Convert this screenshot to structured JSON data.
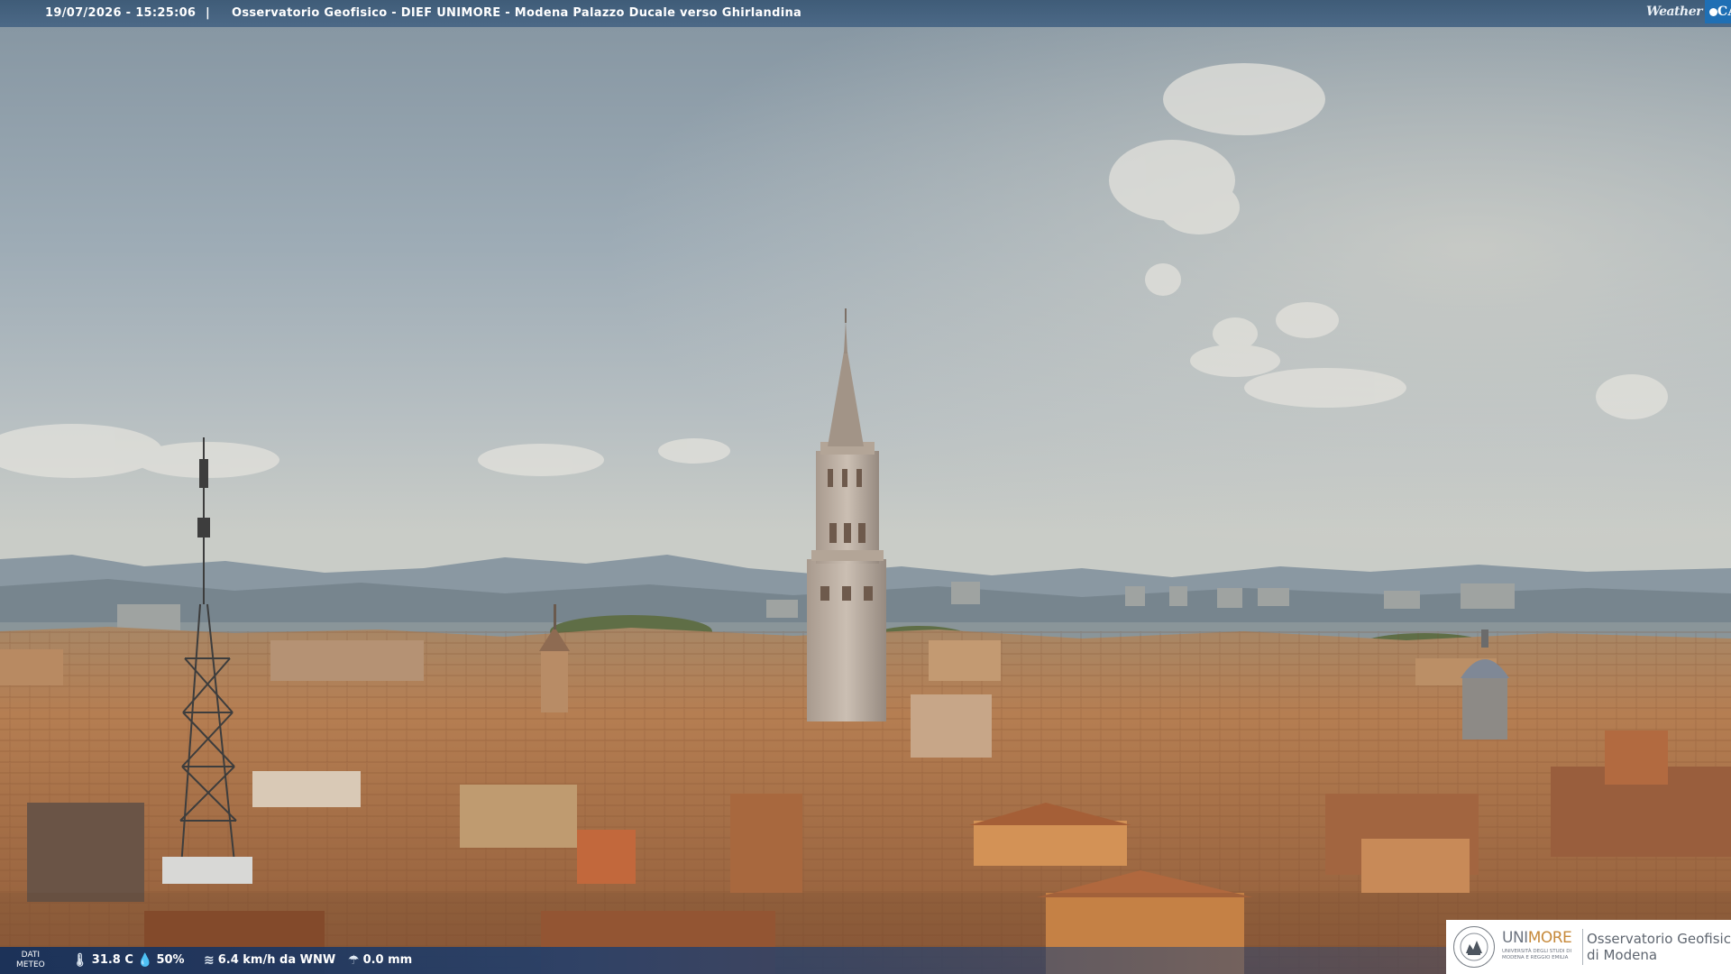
{
  "header": {
    "datetime": "19/07/2026 - 15:25:06",
    "separator": "|",
    "camera_title": "Osservatorio Geofisico - DIEF UNIMORE - Modena Palazzo Ducale verso Ghirlandina",
    "brand_weather": "Weather",
    "brand_cam": "CAM"
  },
  "meteo": {
    "label_line1": "DATI",
    "label_line2": "METEO",
    "temperature": "31.8 C",
    "humidity": "50%",
    "wind": "6.4 km/h da WNW",
    "rain": "0.0 mm",
    "icons": [
      "thermometer-icon",
      "humidity-icon",
      "wind-icon",
      "rain-icon"
    ]
  },
  "institution": {
    "brand_part1": "UNI",
    "brand_part2": "MORE",
    "brand_sub": "UNIVERSITÀ DEGLI STUDI DI MODENA E REGGIO EMILIA",
    "observatory_line1": "Osservatorio Geofisico",
    "observatory_line2": "di Modena"
  },
  "colors": {
    "header_bar": "#46627f",
    "meteo_bar": "#1c3d6e",
    "brand_blue": "#1f6fb4",
    "unimore_gold": "#c6893a",
    "sky_top": "#8b9ba7",
    "roofs": "#b07a4f"
  }
}
